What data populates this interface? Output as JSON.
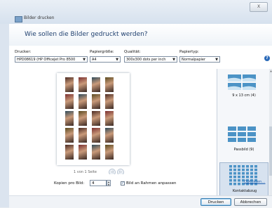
{
  "window": {
    "title": "Bilder drucken",
    "close_glyph": "X"
  },
  "header": {
    "question": "Wie sollen die Bilder gedruckt werden?"
  },
  "settings": {
    "printer": {
      "label": "Drucker:",
      "value": "HPD08619 (HP Officejet Pro 8500"
    },
    "paper_size": {
      "label": "Papiergröße:",
      "value": "A4"
    },
    "quality": {
      "label": "Qualität:",
      "value": "300x300 dots per inch"
    },
    "paper_type": {
      "label": "Papiertyp:",
      "value": "Normalpapier"
    }
  },
  "preview": {
    "page_indicator": "1 von 1 Seite",
    "prev_glyph": "◁",
    "next_glyph": "▷"
  },
  "gallery": {
    "items": [
      {
        "label": "9 x 13 cm (4)"
      },
      {
        "label": "Passbild (9)"
      },
      {
        "label": "Kontaktabzug",
        "selected": true
      }
    ],
    "scroll_up_glyph": "▲",
    "scroll_down_glyph": "▼"
  },
  "copies": {
    "label": "Kopien pro Bild:",
    "value": "4"
  },
  "fit": {
    "label": "Bild an Rahmen anpassen",
    "checked": true,
    "check_glyph": "✓"
  },
  "footer": {
    "options_link": "Optionen...",
    "print_button": "Drucken",
    "cancel_button": "Abbrechen"
  },
  "colors": {
    "accent": "#2a69b8",
    "title_text": "#1e3f6e",
    "link": "#1d5fb0"
  }
}
